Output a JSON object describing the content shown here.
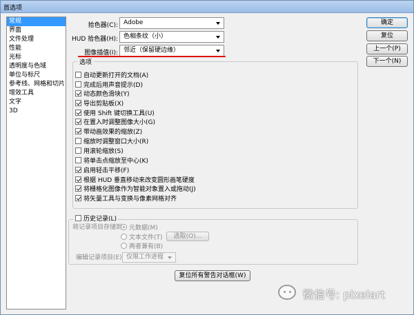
{
  "window": {
    "title": "首选项"
  },
  "sidebar": {
    "items": [
      {
        "label": "常规",
        "selected": true
      },
      {
        "label": "界面"
      },
      {
        "label": "文件处理"
      },
      {
        "label": "性能"
      },
      {
        "label": "光标"
      },
      {
        "label": "透明度与色域"
      },
      {
        "label": "单位与标尺"
      },
      {
        "label": "参考线、网格和切片"
      },
      {
        "label": "增效工具"
      },
      {
        "label": "文字"
      },
      {
        "label": "3D"
      }
    ]
  },
  "fields": {
    "color_picker": {
      "label": "拾色器(C):",
      "value": "Adobe"
    },
    "hud_picker": {
      "label": "HUD 拾色器(H):",
      "value": "色相条纹（小）"
    },
    "interpolation": {
      "label": "图像插值(I):",
      "value": "邻近（保留硬边缘）"
    }
  },
  "buttons": {
    "ok": "确定",
    "reset": "复位",
    "prev": "上一个(P)",
    "next": "下一个(N)",
    "reset_warnings": "复位所有警告对话框(W)",
    "choose": "选取(O)..."
  },
  "options": {
    "legend": "选项",
    "items": [
      {
        "label": "自动更新打开的文档(A)",
        "checked": false
      },
      {
        "label": "完成后用声音提示(D)",
        "checked": false
      },
      {
        "label": "动态颜色滑块(Y)",
        "checked": true
      },
      {
        "label": "导出剪贴板(X)",
        "checked": true
      },
      {
        "label": "使用 Shift 键切换工具(U)",
        "checked": true
      },
      {
        "label": "在置入时调整图像大小(G)",
        "checked": true
      },
      {
        "label": "带动画效果的缩放(Z)",
        "checked": true
      },
      {
        "label": "缩放时调整窗口大小(R)",
        "checked": false
      },
      {
        "label": "用滚轮缩放(S)",
        "checked": false
      },
      {
        "label": "将单击点缩放至中心(K)",
        "checked": false
      },
      {
        "label": "启用轻击平移(F)",
        "checked": true
      },
      {
        "label": "根据 HUD 垂直移动来改变圆形画笔硬度",
        "checked": true
      },
      {
        "label": "将栅格化图像作为智能对象置入或拖动(J)",
        "checked": true
      },
      {
        "label": "将矢量工具与变换与像素网格对齐",
        "checked": true
      }
    ]
  },
  "history": {
    "checkbox_label": "历史记录(L)",
    "checked": false,
    "save_to_label": "将记录项目存储到:",
    "radio": [
      {
        "label": "元数据(M)",
        "selected": true
      },
      {
        "label": "文本文件(T)",
        "selected": false
      },
      {
        "label": "两者兼有(B)",
        "selected": false
      }
    ],
    "edit_label": "编辑记录项目(E):",
    "edit_value": "仅限工作进程"
  },
  "watermark": {
    "text": "微信号: pixelart"
  }
}
